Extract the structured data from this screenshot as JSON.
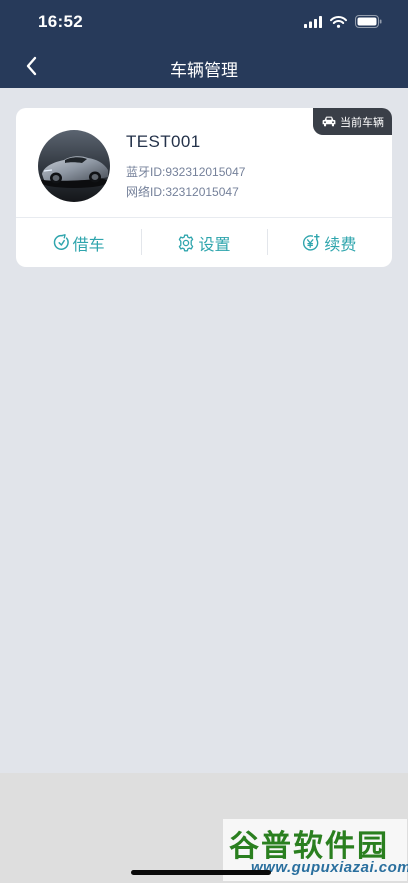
{
  "status_bar": {
    "time": "16:52"
  },
  "nav": {
    "title": "车辆管理"
  },
  "vehicle": {
    "badge": "当前车辆",
    "name": "TEST001",
    "bluetooth_id": "蓝牙ID:932312015047",
    "network_id": "网络ID:32312015047",
    "actions": [
      {
        "label": "借车",
        "icon": "borrow-icon"
      },
      {
        "label": "设置",
        "icon": "gear-icon"
      },
      {
        "label": "续费",
        "icon": "renew-yen-icon"
      }
    ]
  },
  "watermark": {
    "main": "谷普软件园",
    "sub": "www.gupuxiazai.com"
  },
  "colors": {
    "header": "#273a5a",
    "accent": "#2fa5ad",
    "background": "#e1e4ea",
    "badge": "#3a3f48"
  }
}
